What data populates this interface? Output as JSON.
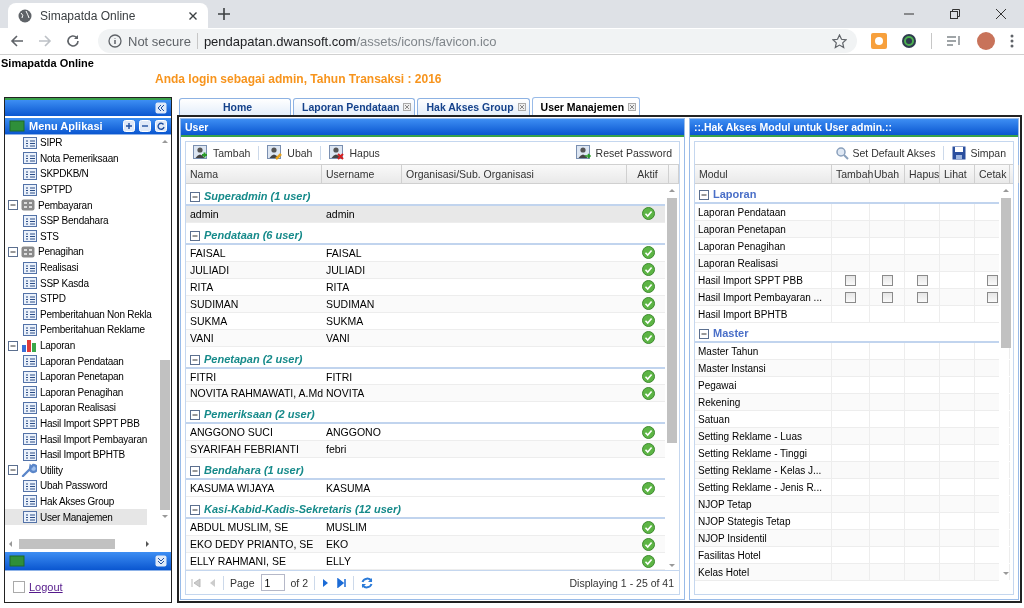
{
  "browser": {
    "tab_title": "Simapatda Online",
    "security": "Not secure",
    "url_host": "pendapatan.dwansoft.com",
    "url_path": "/assets/icons/favicon.ico"
  },
  "app_title": "Simapatda Online",
  "login_notice": "Anda login sebagai admin, Tahun Transaksi : 2016",
  "sidebar": {
    "title": "Menu Aplikasi",
    "tree": [
      {
        "children": [
          {
            "label": "SIPR",
            "selected": false
          },
          {
            "label": "Nota Pemeriksaan",
            "selected": false
          },
          {
            "label": "SKPDKB/N",
            "selected": false
          },
          {
            "label": "SPTPD",
            "selected": false
          }
        ]
      },
      {
        "label": "Pembayaran",
        "expanded": true,
        "children": [
          {
            "label": "SSP Bendahara",
            "selected": false
          },
          {
            "label": "STS",
            "selected": false
          }
        ]
      },
      {
        "label": "Penagihan",
        "expanded": true,
        "children": [
          {
            "label": "Realisasi",
            "selected": false
          },
          {
            "label": "SSP Kasda",
            "selected": false
          },
          {
            "label": "STPD",
            "selected": false
          },
          {
            "label": "Pemberitahuan Non Rekla",
            "selected": false
          },
          {
            "label": "Pemberitahuan Reklame",
            "selected": false
          }
        ]
      },
      {
        "label": "Laporan",
        "expanded": true,
        "children": [
          {
            "label": "Laporan Pendataan",
            "selected": false
          },
          {
            "label": "Laporan Penetapan",
            "selected": false
          },
          {
            "label": "Laporan Penagihan",
            "selected": false
          },
          {
            "label": "Laporan Realisasi",
            "selected": false
          },
          {
            "label": "Hasil Import SPPT PBB",
            "selected": false
          },
          {
            "label": "Hasil Import Pembayaran",
            "selected": false
          },
          {
            "label": "Hasil Import BPHTB",
            "selected": false
          }
        ]
      },
      {
        "label": "Utility",
        "expanded": true,
        "children": [
          {
            "label": "Ubah Password",
            "selected": false
          },
          {
            "label": "Hak Akses Group",
            "selected": false
          },
          {
            "label": "User Manajemen",
            "selected": true
          }
        ]
      }
    ],
    "logout": "Logout"
  },
  "tabs": [
    {
      "label": "Home",
      "selected": false,
      "closable": false
    },
    {
      "label": "Laporan Pendataan",
      "selected": false,
      "closable": true
    },
    {
      "label": "Hak Akses Group",
      "selected": false,
      "closable": true
    },
    {
      "label": "User Manajemen",
      "selected": true,
      "closable": true
    }
  ],
  "user_panel": {
    "title": "User",
    "toolbar": [
      "Tambah",
      "Ubah",
      "Hapus"
    ],
    "reset_button": "Reset Password",
    "columns": [
      "Nama",
      "Username",
      "Organisasi/Sub. Organisasi",
      "Aktif"
    ],
    "groups": [
      {
        "label": "Superadmin (1 user)",
        "expanded": true,
        "rows": [
          {
            "name": "admin",
            "username": "admin",
            "active": true,
            "selected": true
          }
        ]
      },
      {
        "label": "Pendataan (6 user)",
        "expanded": true,
        "rows": [
          {
            "name": "FAISAL",
            "username": "FAISAL",
            "active": true,
            "selected": false
          },
          {
            "name": "JULIADI",
            "username": "JULIADI",
            "active": true,
            "selected": false
          },
          {
            "name": "RITA",
            "username": "RITA",
            "active": true,
            "selected": false
          },
          {
            "name": "SUDIMAN",
            "username": "SUDIMAN",
            "active": true,
            "selected": false
          },
          {
            "name": "SUKMA",
            "username": "SUKMA",
            "active": true,
            "selected": false
          },
          {
            "name": "VANI",
            "username": "VANI",
            "active": true,
            "selected": false
          }
        ]
      },
      {
        "label": "Penetapan (2 user)",
        "expanded": true,
        "rows": [
          {
            "name": "FITRI",
            "username": "FITRI",
            "active": true,
            "selected": false
          },
          {
            "name": "NOVITA RAHMAWATI, A.Md",
            "username": "NOVITA",
            "active": true,
            "selected": false
          }
        ]
      },
      {
        "label": "Pemeriksaan (2 user)",
        "expanded": true,
        "rows": [
          {
            "name": "ANGGONO SUCI",
            "username": "ANGGONO",
            "active": true,
            "selected": false
          },
          {
            "name": "SYARIFAH FEBRIANTI",
            "username": "febri",
            "active": true,
            "selected": false
          }
        ]
      },
      {
        "label": "Bendahara (1 user)",
        "expanded": true,
        "rows": [
          {
            "name": "KASUMA WIJAYA",
            "username": "KASUMA",
            "active": true,
            "selected": false
          }
        ]
      },
      {
        "label": "Kasi-Kabid-Kadis-Sekretaris (12 user)",
        "expanded": true,
        "rows": [
          {
            "name": "ABDUL MUSLIM, SE",
            "username": "MUSLIM",
            "active": true,
            "selected": false
          },
          {
            "name": "EKO DEDY PRIANTO, SE",
            "username": "EKO",
            "active": true,
            "selected": false
          },
          {
            "name": "ELLY RAHMANI, SE",
            "username": "ELLY",
            "active": true,
            "selected": false
          }
        ]
      }
    ],
    "pager": {
      "page_label": "Page",
      "page": "1",
      "page_count": "of 2",
      "display": "Displaying 1 - 25 of 41"
    }
  },
  "access_panel": {
    "title": "::.Hak Akses Modul untuk User admin.::",
    "default_button": "Set Default Akses",
    "save_button": "Simpan",
    "columns": [
      "Modul",
      "Tambah",
      "Ubah",
      "Hapus",
      "Lihat",
      "Cetak"
    ],
    "groups": [
      {
        "label": "Laporan",
        "expanded": true,
        "rows": [
          {
            "module": "Laporan Pendataan"
          },
          {
            "module": "Laporan Penetapan"
          },
          {
            "module": "Laporan Penagihan"
          },
          {
            "module": "Laporan Realisasi"
          },
          {
            "module": "Hasil Import SPPT PBB",
            "cells": [
              {
                "kind": "checkbox",
                "checked": false
              },
              {
                "kind": "checkbox",
                "checked": false
              },
              {
                "kind": "checkbox",
                "checked": false
              },
              {
                "kind": "blank"
              },
              {
                "kind": "checkbox",
                "checked": false
              }
            ]
          },
          {
            "module": "Hasil Import Pembayaran ...",
            "cells": [
              {
                "kind": "checkbox",
                "checked": false
              },
              {
                "kind": "checkbox",
                "checked": false
              },
              {
                "kind": "checkbox",
                "checked": false
              },
              {
                "kind": "blank"
              },
              {
                "kind": "checkbox",
                "checked": false
              }
            ]
          },
          {
            "module": "Hasil Import BPHTB"
          }
        ]
      },
      {
        "label": "Master",
        "expanded": true,
        "rows": [
          {
            "module": "Master Tahun"
          },
          {
            "module": "Master Instansi"
          },
          {
            "module": "Pegawai"
          },
          {
            "module": "Rekening"
          },
          {
            "module": "Satuan"
          },
          {
            "module": "Setting Reklame - Luas"
          },
          {
            "module": "Setting Reklame - Tinggi"
          },
          {
            "module": "Setting Reklame - Kelas J..."
          },
          {
            "module": "Setting Reklame - Jenis R..."
          },
          {
            "module": "NJOP Tetap"
          },
          {
            "module": "NJOP Stategis Tetap"
          },
          {
            "module": "NJOP Insidentil"
          },
          {
            "module": "Fasilitas Hotel"
          },
          {
            "module": "Kelas Hotel"
          }
        ]
      }
    ]
  }
}
